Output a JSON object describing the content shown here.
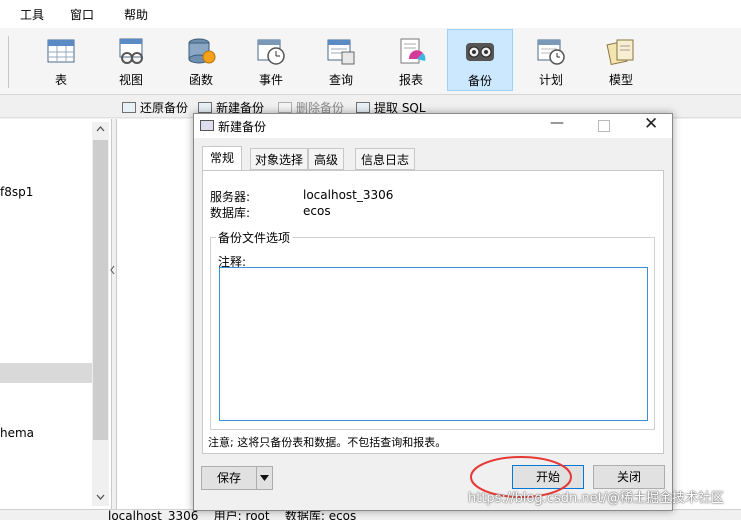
{
  "menu": [
    "工具",
    "窗口",
    "帮助"
  ],
  "toolbar": [
    {
      "label": "表",
      "icon": "table-icon"
    },
    {
      "label": "视图",
      "icon": "view-icon"
    },
    {
      "label": "函数",
      "icon": "function-icon"
    },
    {
      "label": "事件",
      "icon": "event-icon"
    },
    {
      "label": "查询",
      "icon": "query-icon"
    },
    {
      "label": "报表",
      "icon": "report-icon"
    },
    {
      "label": "备份",
      "icon": "backup-icon",
      "active": true
    },
    {
      "label": "计划",
      "icon": "schedule-icon"
    },
    {
      "label": "模型",
      "icon": "model-icon"
    }
  ],
  "subtoolbar": [
    {
      "label": "还原备份",
      "enabled": true
    },
    {
      "label": "新建备份",
      "enabled": true
    },
    {
      "label": "删除备份",
      "enabled": false
    },
    {
      "label": "提取 SQL",
      "enabled": true
    }
  ],
  "tree": {
    "item1": "f8sp1",
    "item2": "hema"
  },
  "status": {
    "text": "localhost_3306    用户: root    数据库: ecos"
  },
  "dialog": {
    "title": "新建备份",
    "tabs": [
      "常规",
      "对象选择",
      "高级",
      "信息日志"
    ],
    "server_label": "服务器:",
    "server_value": "localhost_3306",
    "database_label": "数据库:",
    "database_value": "ecos",
    "group_title": "备份文件选项",
    "comment_label": "注释:",
    "comment_value": "",
    "note": "注意; 这将只备份表和数据。不包括查询和报表。",
    "save_label": "保存",
    "start_label": "开始",
    "close_label": "关闭"
  },
  "watermark": "https://blog.csdn.net/@稀土掘金技术社区",
  "colors": {
    "active_tool_bg": "#cce8ff",
    "highlight_circle": "#e53935",
    "primary_border": "#0078d7"
  }
}
